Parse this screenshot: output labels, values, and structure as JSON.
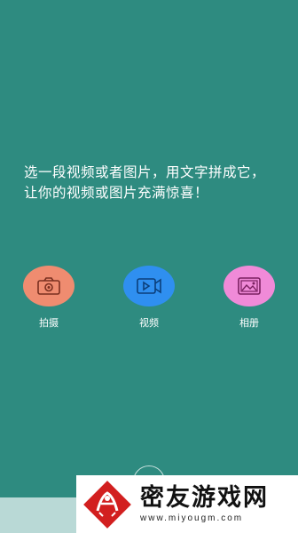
{
  "intro": {
    "line1": "选一段视频或者图片，用文字拼成它，",
    "line2": "让你的视频或图片充满惊喜！"
  },
  "actions": [
    {
      "label": "拍摄",
      "icon": "camera-icon",
      "color": "#ef8c70"
    },
    {
      "label": "视频",
      "icon": "video-icon",
      "color": "#2f8ff0"
    },
    {
      "label": "相册",
      "icon": "album-icon",
      "color": "#f08ad8"
    }
  ],
  "watermark": {
    "title": "密友游戏网",
    "url": "www.miyougm.com"
  }
}
